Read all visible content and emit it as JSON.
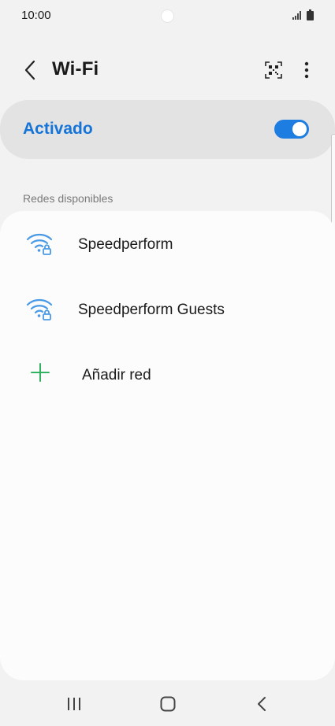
{
  "status_bar": {
    "time": "10:00"
  },
  "header": {
    "title": "Wi-Fi"
  },
  "wifi_toggle": {
    "label": "Activado",
    "enabled": true,
    "accent_color": "#1e7de0"
  },
  "networks": {
    "section_label": "Redes disponibles",
    "items": [
      {
        "name": "Speedperform",
        "secured": true
      },
      {
        "name": "Speedperform Guests",
        "secured": true
      }
    ],
    "add_label": "Añadir red"
  },
  "colors": {
    "wifi_icon": "#4a9ae6",
    "add_icon": "#2fb360",
    "background": "#f2f2f2"
  }
}
